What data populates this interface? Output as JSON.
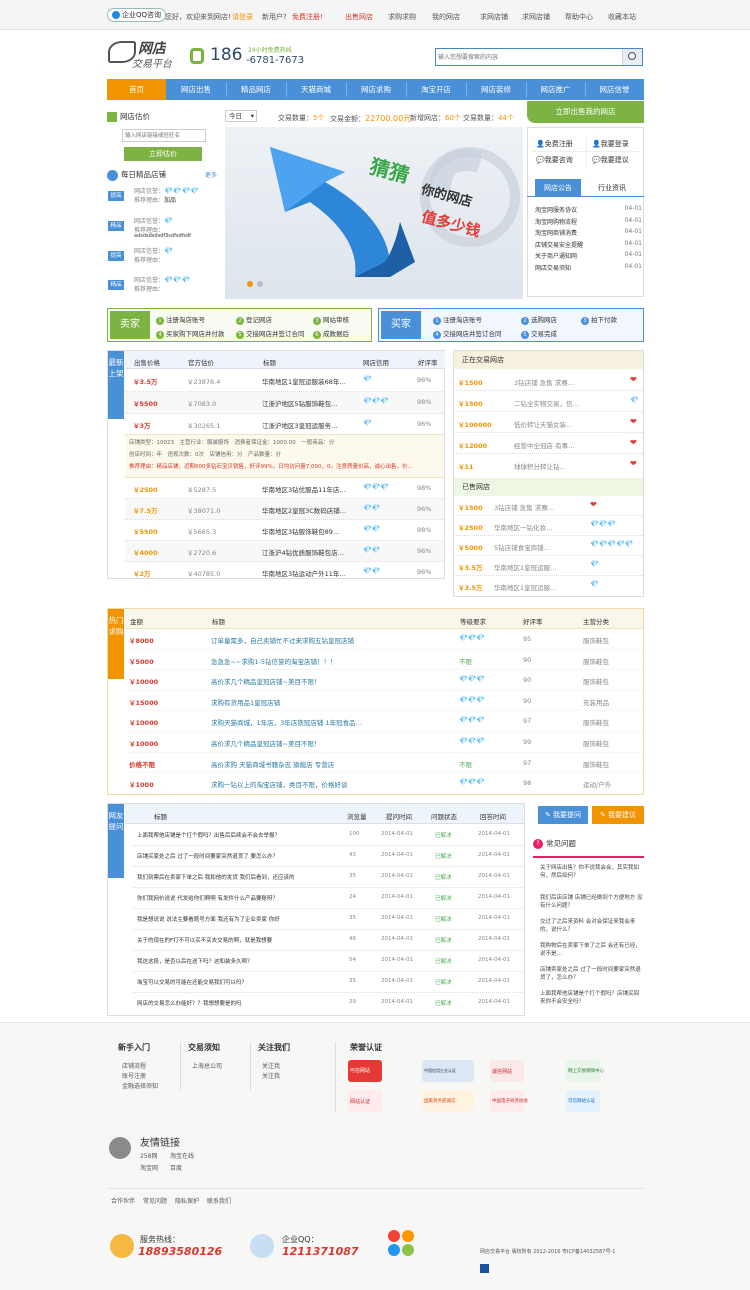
{
  "topbar": {
    "qq_label": "企业QQ咨询",
    "welcome": "您好，欢迎来到网店!",
    "login": "请登录",
    "account": "新用户?",
    "register": "免费注册!",
    "links": [
      "出售网店",
      "求购求购",
      "我的网店",
      "求网店铺",
      "求网店铺",
      "求职服务",
      "帮助中心",
      "收藏本站"
    ]
  },
  "logo": {
    "line1": "网店",
    "line2": "交易平台"
  },
  "hotline": {
    "prefix": "186",
    "number": "-6781-7673",
    "note": "24小时免费热线"
  },
  "search": {
    "placeholder": "输入您想要搜索的内容"
  },
  "nav": [
    "首页",
    "网店出售",
    "精品网店",
    "天猫商城",
    "网店求购",
    "淘宝开店",
    "网店装修",
    "网店推广",
    "网店信誉"
  ],
  "open_button": "立即出售我的网店",
  "market": {
    "est_title": "网店估价",
    "est_select": "今日",
    "est_input_placeholder": "输入网店链接或旺旺名",
    "est_button": "立即估价",
    "stats": [
      {
        "k": "交易数量：",
        "v": "5个"
      },
      {
        "k": "交易金额：",
        "v": "22700.00元"
      },
      {
        "k": "新增网店：",
        "v": "60个"
      },
      {
        "k": "交易数量：",
        "v": "44个"
      }
    ]
  },
  "daily": {
    "title": "每日精品店铺",
    "more": "更多",
    "items": [
      {
        "tag": "提高",
        "rep_label": "网店信誉：",
        "rep": "💎💎💎💎",
        "reason_label": "推荐理由：",
        "reason": "加品"
      },
      {
        "tag": "精品",
        "rep_label": "网店信誉：",
        "rep": "💎",
        "reason_label": "推荐理由：",
        "reason": "adsdsdsdsdf3sdfsdfsdf"
      },
      {
        "tag": "提高",
        "rep_label": "网店信誉：",
        "rep": "💎",
        "reason_label": "推荐理由：",
        "reason": ""
      },
      {
        "tag": "精品",
        "rep_label": "网店信誉：",
        "rep": "💎💎💎",
        "reason_label": "推荐理由：",
        "reason": ""
      }
    ]
  },
  "hero": {
    "line1": "猜猜",
    "line2": "你的网店",
    "line3": "值多少钱"
  },
  "quick": [
    {
      "label": "免费注册",
      "icon": "user-icon"
    },
    {
      "label": "我要登录",
      "icon": "user-icon"
    },
    {
      "label": "我要咨询",
      "icon": "chat-icon"
    },
    {
      "label": "我要建议",
      "icon": "chat-icon"
    }
  ],
  "tabs": {
    "active": "网店公告",
    "other": "行业资讯"
  },
  "news": [
    {
      "t": "淘宝网服务协议",
      "d": "04-01"
    },
    {
      "t": "淘宝网购物流程",
      "d": "04-01"
    },
    {
      "t": "淘宝网商铺消费",
      "d": "04-01"
    },
    {
      "t": "店铺交易安全提醒",
      "d": "04-01"
    },
    {
      "t": "关于商户通知网",
      "d": "04-01"
    },
    {
      "t": "网店交易须知",
      "d": "04-01"
    }
  ],
  "seller_steps": {
    "label": "卖家",
    "steps": [
      "注册淘店账号",
      "登记网店",
      "网站审核",
      "买家购下网店并付款",
      "交接网店并签订合同",
      "成数据后"
    ]
  },
  "buyer_steps": {
    "label": "买家",
    "steps": [
      "注册淘店账号",
      "选购网店",
      "拍下付款",
      "交接网店并签订合同",
      "交易完成"
    ]
  },
  "latest": {
    "vlabel": "最新上架",
    "headers": [
      "出售价格",
      "官方估价",
      "标题",
      "网店信用",
      "好评率"
    ],
    "rows": [
      {
        "price": "￥3.5万",
        "est": "￥23876.4",
        "title": "华南地区1皇冠运服装68年…",
        "rep": "💎",
        "rate": "96%"
      },
      {
        "price": "￥5500",
        "est": "￥7083.0",
        "title": "江浙沪地区5钻服饰鞋包…",
        "rep": "💎💎💎",
        "rate": "98%"
      },
      {
        "price": "￥3万",
        "est": "￥30265.1",
        "title": "江浙沪地区3皇冠运服务…",
        "rep": "💎",
        "rate": "96%"
      }
    ],
    "detail": [
      "店铺类型：10023　主营行业：服装服饰　消费者保证金：1000.00　一般商品：分",
      "创店时间：年　违规次数：0次　店铺信用：分　产品数量：分",
      "推荐理由：精品店铺，近期600多钻石宝贝销售，好评99%，日均访问量7,000，0。注意质量价高，诚心出售，价…"
    ],
    "rows2": [
      {
        "price": "￥2500",
        "est": "￥5287.5",
        "title": "华南地区3钻优服品11年店…",
        "rep": "💎💎💎",
        "rate": "98%"
      },
      {
        "price": "￥7.5万",
        "est": "￥38071.0",
        "title": "华南地区2皇冠3C数码店铺…",
        "rep": "💎💎",
        "rate": "96%"
      },
      {
        "price": "￥5500",
        "est": "￥5665.3",
        "title": "华南地区3钻服饰鞋包89…",
        "rep": "💎💎",
        "rate": "98%"
      },
      {
        "price": "￥4000",
        "est": "￥2720.6",
        "title": "江浙沪4钻优质服饰鞋包店…",
        "rep": "💎💎",
        "rate": "96%"
      },
      {
        "price": "￥2万",
        "est": "￥40785.0",
        "title": "华南地区3钻运动户外11年…",
        "rep": "💎💎",
        "rate": "96%"
      }
    ]
  },
  "selling": {
    "title": "正在交易网店",
    "rows": [
      {
        "price": "￥1500",
        "title": "3钻店铺 急售 求赛…",
        "mark": "heart"
      },
      {
        "price": "￥1500",
        "title": "二钻全实物交易，信…",
        "mark": "diamond"
      },
      {
        "price": "￥100000",
        "title": "低价转让天猫女装…",
        "mark": "heart"
      },
      {
        "price": "￥12000",
        "title": "经营中全冠店 有事…",
        "mark": "heart"
      },
      {
        "price": "￥11",
        "title": "球球积分转让钻…",
        "mark": "heart"
      }
    ]
  },
  "sold": {
    "title": "已售网店",
    "rows": [
      {
        "price": "￥1500",
        "title": "3钻店铺 急售 求赛…",
        "rep": "❤"
      },
      {
        "price": "￥2500",
        "title": "华南地区一钻化妆…",
        "rep": "💎💎💎"
      },
      {
        "price": "￥5000",
        "title": "5钻店铺食宝商铺…",
        "rep": "💎💎💎💎💎"
      },
      {
        "price": "￥3.5万",
        "title": "华南地区1皇冠运服…",
        "rep": "💎"
      },
      {
        "price": "￥3.5万",
        "title": "华南地区1皇冠运服…",
        "rep": "💎"
      }
    ]
  },
  "hot": {
    "vlabel": "热门求购",
    "headers": [
      "金额",
      "标题",
      "等级要求",
      "好评率",
      "主营分类"
    ],
    "rows": [
      {
        "price": "￥8000",
        "title": "订单量需多，自己卖铺忙不过来求购五钻皇冠店铺",
        "level": "💎💎💎",
        "rate": "95",
        "cat": "服饰鞋包"
      },
      {
        "price": "￥5000",
        "title": "急急急~~求购1-5钻信誉的淘宝店铺！！！",
        "level": "不限",
        "rate": "90",
        "cat": "服饰鞋包"
      },
      {
        "price": "￥10000",
        "title": "高价求几个精品皇冠店铺~美目不限！",
        "level": "💎💎💎",
        "rate": "90",
        "cat": "服饰鞋包"
      },
      {
        "price": "￥15000",
        "title": "求购有货用品1皇冠店铺",
        "level": "💎💎💎",
        "rate": "90",
        "cat": "充装用品"
      },
      {
        "price": "￥10000",
        "title": "求购天猫商城，1年店，3年店铁冠店铺 1年冠食品…",
        "level": "💎💎💎",
        "rate": "97",
        "cat": "服饰鞋包"
      },
      {
        "price": "￥10000",
        "title": "高价求几个精品皇冠店铺~美目不限！",
        "level": "💎💎💎",
        "rate": "99",
        "cat": "服饰鞋包"
      },
      {
        "price": "价格不限",
        "title": "高价求购 天猫商城书籍杂志 旗舰店 专营店",
        "level": "不限",
        "rate": "97",
        "cat": "服饰鞋包"
      },
      {
        "price": "￥1000",
        "title": "求购一钻以上的淘宝店铺，类目不限，价格好谈",
        "level": "💎💎💎",
        "rate": "98",
        "cat": "运动/户外"
      }
    ]
  },
  "qa": {
    "vlabel": "网友提问",
    "headers": [
      "标题",
      "浏览量",
      "提问时间",
      "问题状态",
      "回答时间"
    ],
    "rows": [
      {
        "t": "上面我帮他店铺是个打个假吗？出售后后续会不会去举报？",
        "v": "100",
        "d1": "2014-04-01",
        "s": "已解决",
        "d2": "2014-04-01"
      },
      {
        "t": "店铺买家处之后 过了一段时间要家突然退货了 要怎么办？",
        "v": "43",
        "d1": "2014-04-01",
        "s": "已解决",
        "d2": "2014-04-01"
      },
      {
        "t": "我们到票后在卖家下单之后 我和他的发货 我们后看到，还应该的",
        "v": "35",
        "d1": "2014-04-01",
        "s": "已解决",
        "d2": "2014-04-01"
      },
      {
        "t": "你们我网价说说 代发给你们啊啊 有发件什么产品要账呀？",
        "v": "24",
        "d1": "2014-04-01",
        "s": "已解决",
        "d2": "2014-04-01"
      },
      {
        "t": "我是想说说 说法主要看题号方面 我还有为了企业卖家 你好",
        "v": "35",
        "d1": "2014-04-01",
        "s": "已解决",
        "d2": "2014-04-01"
      },
      {
        "t": "关于的现在的F打不可以买不买去交易的啊，就是我想要",
        "v": "46",
        "d1": "2014-04-01",
        "s": "已解决",
        "d2": "2014-04-01"
      },
      {
        "t": "我这这段，是否以后在送下吗？这和装多久啊？",
        "v": "54",
        "d1": "2014-04-01",
        "s": "已解决",
        "d2": "2014-04-01"
      },
      {
        "t": "淘宝可以交易的可能在还能交易我们可以吗？",
        "v": "35",
        "d1": "2014-04-01",
        "s": "已解决",
        "d2": "2014-04-01"
      },
      {
        "t": "网店的交易怎么办能好？？我想想要是的吗",
        "v": "29",
        "d1": "2014-04-01",
        "s": "已解决",
        "d2": "2014-04-01"
      }
    ],
    "ask_button": "我要提问",
    "suggest_button": "我要建议",
    "faq_title": "常见问题",
    "faq": [
      "关于网店出售？你不说我会会，其实我如何，然后如何？",
      "我们后店店铺 店铺已经做到个方便地方 没有什么问题？",
      "交过了之后来资料 会对会保证来我会来的，说什么？",
      "我购物后在卖家下单了之后 会还有已经，说不是…",
      "店铺卖家处之后 过了一段时间要家突然退货了，怎么办？",
      "上面我帮他店铺是个打个假吗？店铺买回来你不会安全吗？"
    ]
  },
  "footer": {
    "cols": [
      {
        "title": "新手入门",
        "items": [
          "店铺流程",
          "账号注册",
          "金融选择须知"
        ]
      },
      {
        "title": "交易须知",
        "items": [
          "上海总公司"
        ]
      },
      {
        "title": "关注我们",
        "items": [
          "关注我",
          "关注我"
        ]
      }
    ],
    "honor_title": "荣誉认证",
    "honors": [
      "可信网站",
      "中国信用企业认证",
      "诚信网站",
      "网上交易保障中心",
      "网站认证",
      "国家商务部诚信",
      "中国电子商务协会",
      "可信网站认证"
    ],
    "friend_title": "友情链接",
    "friend_links": [
      "258网",
      "淘宝在线",
      "淘宝网",
      "百度"
    ],
    "bottom_links": [
      "合作伙伴",
      "常见问题",
      "隐私保护",
      "联系我们"
    ],
    "hotline_label": "服务热线：",
    "hotline": "18893580126",
    "qq_label": "企业QQ：",
    "qq": "1211371087",
    "copyright": "网店交易平台 版权所有 2012-2016 粤ICP备14032587号-1"
  },
  "colors": {
    "blue": "#4a90d9",
    "orange": "#f29400",
    "green": "#7cb342",
    "red": "#d9372c"
  }
}
